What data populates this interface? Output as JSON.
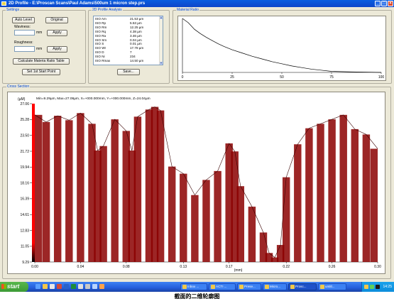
{
  "window": {
    "title": "2D Profile - E:\\Proscan Scans\\Paul Adams\\500um 1 micron step.prs"
  },
  "settings": {
    "group_label": "Settings",
    "auto_level": "Auto Level",
    "original": "Original",
    "waviness_label": "Waviness:",
    "waviness_unit": "mm",
    "apply": "Apply",
    "roughness_label": "Roughness:",
    "roughness_unit": "mm",
    "calc_button": "Calculate Materia Ratio Table",
    "start_button": "Set 1st Start Point"
  },
  "analysis": {
    "group_label": "2D Profile Analysis",
    "rows": [
      {
        "name": "ISO Am",
        "value": "21.53 µm"
      },
      {
        "name": "ISO Rp",
        "value": "5.53 µm"
      },
      {
        "name": "ISO Rm",
        "value": "12.25 µm"
      },
      {
        "name": "ISO Rq",
        "value": "4.38 µm"
      },
      {
        "name": "ISO Ra",
        "value": "3.46 µm"
      },
      {
        "name": "ISO Sm",
        "value": "0.04 µm"
      },
      {
        "name": "ISO S",
        "value": "0.01 µm"
      },
      {
        "name": "ISO Wt",
        "value": "17.78 µm"
      },
      {
        "name": "ISO D",
        "value": "7"
      },
      {
        "name": "ISO Ni",
        "value": "234"
      },
      {
        "name": "ISO Rmax",
        "value": "14.50 µm"
      }
    ],
    "save_button": "Save..."
  },
  "material_ratio": {
    "group_label": "Material Ratio",
    "chart_data": {
      "type": "line",
      "x": [
        0,
        3,
        6,
        9,
        12,
        15,
        18,
        21,
        25,
        30,
        35,
        40,
        45,
        50,
        55,
        60,
        65,
        70,
        75,
        80,
        85,
        90,
        95,
        100
      ],
      "values": [
        1.0,
        0.92,
        0.8,
        0.72,
        0.65,
        0.59,
        0.53,
        0.48,
        0.42,
        0.36,
        0.3,
        0.25,
        0.2,
        0.16,
        0.12,
        0.09,
        0.06,
        0.04,
        0.02,
        0.015,
        0.01,
        0.007,
        0.004,
        0.0
      ],
      "xlim": [
        0,
        100
      ],
      "xticks": [
        "0",
        "25",
        "50",
        "75",
        "100"
      ],
      "color": "#000000"
    }
  },
  "cross_section": {
    "group_label": "Cross Section",
    "info": "Min=9.29µm, Max=27.06µm,  X=+000.000mm,  Y=+000.000mm,  Z=24.04µm",
    "chart_data": {
      "type": "bar",
      "ylabel": "(µM)",
      "xlabel": "(mm)",
      "ylim": [
        9.29,
        27.06
      ],
      "xlim": [
        0.0,
        0.3
      ],
      "yticks": [
        "27.06",
        "25.28",
        "23.50",
        "21.72",
        "19.94",
        "18.16",
        "16.39",
        "14.61",
        "12.83",
        "11.05",
        "9.29"
      ],
      "xticks": [
        "0.00",
        "0.04",
        "0.08",
        "0.13",
        "0.17",
        "0.22",
        "0.26",
        "0.30"
      ],
      "x": [
        0.0,
        0.01,
        0.02,
        0.03,
        0.04,
        0.05,
        0.055,
        0.06,
        0.07,
        0.08,
        0.085,
        0.09,
        0.1,
        0.105,
        0.11,
        0.12,
        0.13,
        0.14,
        0.15,
        0.16,
        0.17,
        0.175,
        0.18,
        0.19,
        0.2,
        0.205,
        0.21,
        0.215,
        0.22,
        0.23,
        0.24,
        0.25,
        0.26,
        0.27,
        0.28,
        0.29,
        0.3
      ],
      "values": [
        25.8,
        25.0,
        25.7,
        25.2,
        26.0,
        24.8,
        21.8,
        22.3,
        25.3,
        24.0,
        21.8,
        25.6,
        26.4,
        26.7,
        26.3,
        20.0,
        19.2,
        16.8,
        18.5,
        19.5,
        22.6,
        21.7,
        17.8,
        15.5,
        12.6,
        10.3,
        9.8,
        11.2,
        18.8,
        22.5,
        24.3,
        24.8,
        25.3,
        25.8,
        24.2,
        23.6,
        22.0
      ],
      "bar_color": "#8b0000",
      "scale_colors": [
        "#ff0000",
        "#000000"
      ]
    }
  },
  "taskbar": {
    "start": "start",
    "tasks": [
      "Inbox ...",
      "ACTI ...",
      "Prese...",
      "Micro...",
      "Prosc...",
      "untitl..."
    ],
    "clock": "14:25"
  },
  "caption": "截面的二维轮廓图"
}
